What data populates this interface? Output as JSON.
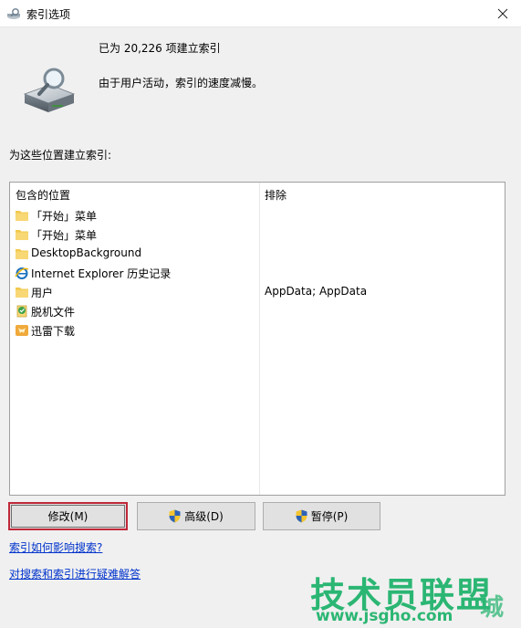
{
  "window": {
    "title": "索引选项"
  },
  "status": {
    "count_text": "已为 20,226 项建立索引",
    "message": "由于用户活动，索引的速度减慢。"
  },
  "section_label": "为这些位置建立索引:",
  "list": {
    "columns": {
      "included": "包含的位置",
      "excluded": "排除"
    },
    "rows": [
      {
        "name": "「开始」菜单",
        "excluded": "",
        "icon": "folder-icon"
      },
      {
        "name": "「开始」菜单",
        "excluded": "",
        "icon": "folder-icon"
      },
      {
        "name": "DesktopBackground",
        "excluded": "",
        "icon": "folder-icon"
      },
      {
        "name": "Internet Explorer 历史记录",
        "excluded": "",
        "icon": "ie-icon"
      },
      {
        "name": "用户",
        "excluded": "AppData; AppData",
        "icon": "folder-icon"
      },
      {
        "name": "脱机文件",
        "excluded": "",
        "icon": "offline-files-icon"
      },
      {
        "name": "迅雷下载",
        "excluded": "",
        "icon": "thunder-folder-icon"
      }
    ]
  },
  "buttons": {
    "modify": "修改(M)",
    "advanced": "高级(D)",
    "pause": "暂停(P)"
  },
  "links": {
    "how_affects": "索引如何影响搜索?",
    "troubleshoot": "对搜索和索引进行疑难解答"
  },
  "watermark": {
    "main": "技术员联盟",
    "sub": "www.jsgho.com",
    "city": "城"
  },
  "colors": {
    "accent_focus": "#c0283a",
    "link": "#0033cc",
    "watermark": "#2bb673"
  }
}
